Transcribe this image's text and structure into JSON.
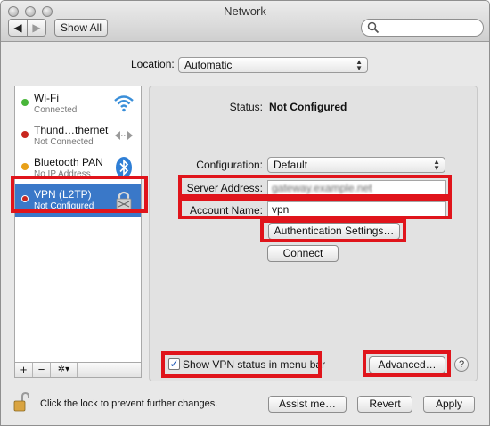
{
  "window": {
    "title": "Network"
  },
  "toolbar": {
    "show_all_label": "Show All"
  },
  "location": {
    "label": "Location:",
    "value": "Automatic"
  },
  "services": [
    {
      "name": "Wi-Fi",
      "status": "Connected",
      "status_color": "#49b63a",
      "icon": "wifi-icon"
    },
    {
      "name": "Thund…thernet",
      "status": "Not Connected",
      "status_color": "#c8261e",
      "icon": "ethernet-arrows-icon"
    },
    {
      "name": "Bluetooth PAN",
      "status": "No IP Address",
      "status_color": "#e8a018",
      "icon": "bluetooth-icon"
    },
    {
      "name": "VPN (L2TP)",
      "status": "Not Configured",
      "status_color": "#c8261e",
      "icon": "vpn-lock-icon",
      "selected": true
    }
  ],
  "sidebar_controls": {
    "add": "+",
    "remove": "−",
    "action": "✲▾"
  },
  "detail": {
    "status_label": "Status:",
    "status_value": "Not Configured",
    "configuration_label": "Configuration:",
    "configuration_value": "Default",
    "server_address_label": "Server Address:",
    "server_address_value": "gateway.example.net",
    "account_name_label": "Account Name:",
    "account_name_value": "vpn",
    "auth_settings_label": "Authentication Settings…",
    "connect_label": "Connect",
    "show_vpn_status_label": "Show VPN status in menu bar",
    "show_vpn_status_checked": true,
    "advanced_label": "Advanced…",
    "help_label": "?"
  },
  "footer": {
    "lock_text": "Click the lock to prevent further changes.",
    "assist_label": "Assist me…",
    "revert_label": "Revert",
    "apply_label": "Apply"
  },
  "colors": {
    "highlight": "#e0141b",
    "selection": "#3a78c8"
  }
}
